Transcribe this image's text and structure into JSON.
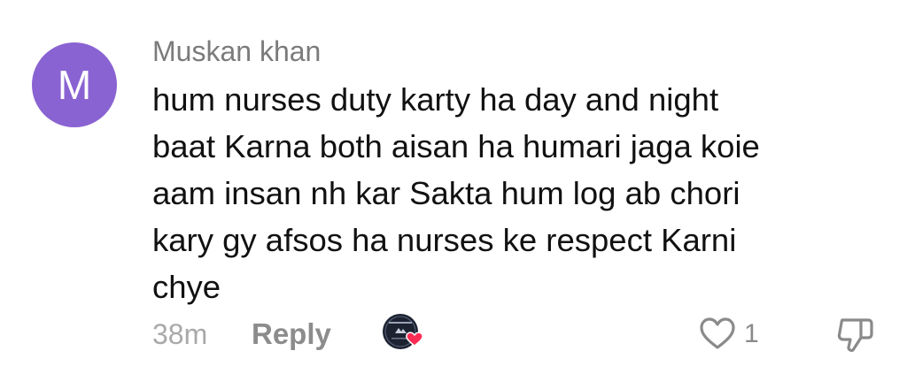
{
  "comment": {
    "avatar_letter": "M",
    "username": "Muskan khan",
    "text_lines": [
      "hum nurses duty karty ha day and night",
      "baat Karna both aisan ha humari jaga koie",
      "aam insan nh kar Sakta hum log ab chori",
      "kary gy afsos ha nurses ke respect Karni",
      "chye"
    ],
    "timestamp": "38m",
    "reply_label": "Reply",
    "like_count": "1",
    "creator_liked": true
  },
  "colors": {
    "avatar": "#8a63d2",
    "creator_heart": "#fe2c55",
    "text_primary": "#111111",
    "text_secondary": "#8c8c8c"
  },
  "icons": {
    "like": "heart-outline-icon",
    "dislike": "thumbs-down-icon",
    "creator_like": "creator-liked-badge"
  }
}
